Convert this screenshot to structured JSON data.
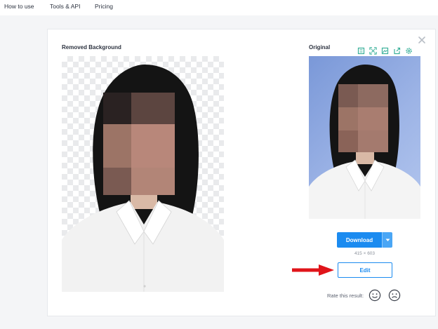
{
  "nav": {
    "items": [
      "How to use",
      "Tools & API",
      "Pricing"
    ]
  },
  "result": {
    "removed_title": "Removed Background",
    "original_title": "Original",
    "download_label": "Download",
    "dimensions": "415 × 603",
    "edit_label": "Edit",
    "rate_label": "Rate this result:"
  },
  "icons": {
    "close": "close-icon",
    "toolbar": [
      "crop-icon",
      "expand-icon",
      "image-icon",
      "share-icon",
      "settings-icon"
    ],
    "rating": [
      "smile-icon",
      "frown-icon"
    ],
    "dropdown": "caret-down-icon"
  },
  "colors": {
    "primary": "#1b8bf0",
    "tool_icons": "#3ab09a",
    "arrow": "#e0141a",
    "original_bg": "#8fa8e0"
  }
}
